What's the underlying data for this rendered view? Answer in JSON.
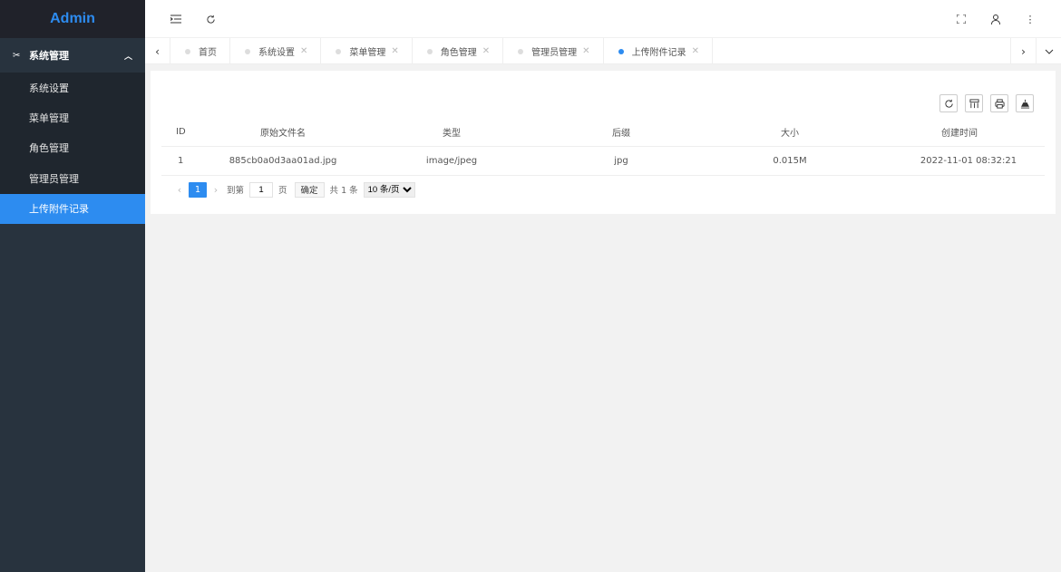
{
  "app": {
    "title": "Admin"
  },
  "sidebar": {
    "group": {
      "icon": "tools-icon",
      "label": "系统管理",
      "chevron": "chevron-up-icon"
    },
    "items": [
      {
        "label": "系统设置",
        "active": false
      },
      {
        "label": "菜单管理",
        "active": false
      },
      {
        "label": "角色管理",
        "active": false
      },
      {
        "label": "管理员管理",
        "active": false
      },
      {
        "label": "上传附件记录",
        "active": true
      }
    ]
  },
  "header": {
    "left_icons": [
      "menu-fold-icon",
      "refresh-icon"
    ],
    "right_icons": [
      "fullscreen-icon",
      "user-icon",
      "more-icon"
    ]
  },
  "tabs": [
    {
      "label": "首页",
      "closable": false,
      "active": false
    },
    {
      "label": "系统设置",
      "closable": true,
      "active": false
    },
    {
      "label": "菜单管理",
      "closable": true,
      "active": false
    },
    {
      "label": "角色管理",
      "closable": true,
      "active": false
    },
    {
      "label": "管理员管理",
      "closable": true,
      "active": false
    },
    {
      "label": "上传附件记录",
      "closable": true,
      "active": true
    }
  ],
  "toolbar": {
    "buttons": [
      "refresh-icon",
      "columns-icon",
      "print-icon",
      "export-icon"
    ]
  },
  "table": {
    "columns": [
      "ID",
      "原始文件名",
      "类型",
      "后缀",
      "大小",
      "创建时间"
    ],
    "rows": [
      [
        "1",
        "885cb0a0d3aa01ad.jpg",
        "image/jpeg",
        "jpg",
        "0.015M",
        "2022-11-01 08:32:21"
      ]
    ]
  },
  "pagination": {
    "current_page": "1",
    "goto_prefix": "到第",
    "goto_value": "1",
    "goto_suffix": "页",
    "confirm_label": "确定",
    "total_text": "共 1 条",
    "page_size": "10 条/页"
  },
  "colors": {
    "accent": "#2d8cf0",
    "sidebar_bg": "#28333e",
    "logo_bg": "#20222a"
  }
}
